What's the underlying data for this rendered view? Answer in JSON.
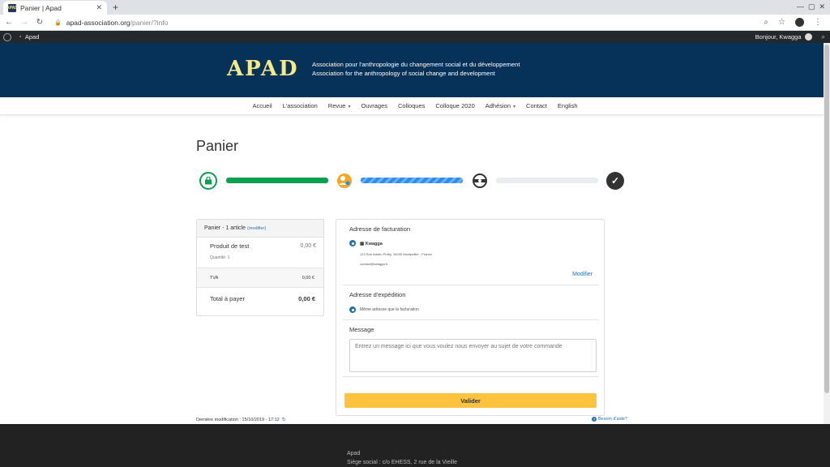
{
  "browser": {
    "tab_title": "Panier | Apad",
    "favicon_text": "APAD",
    "url_host": "apad-association.org",
    "url_path": "/panier/?info"
  },
  "wpbar": {
    "site_name": "Apad",
    "greeting": "Bonjour, Kwagga"
  },
  "header": {
    "logo": "APAD",
    "tagline_fr": "Association pour l'anthropologie du changement social et du développement",
    "tagline_en": "Association for the anthropology of social change and development"
  },
  "nav": {
    "items": [
      "Accueil",
      "L'association",
      "Revue",
      "Ouvrages",
      "Colloques",
      "Colloque 2020",
      "Adhésion",
      "Contact",
      "English"
    ]
  },
  "page": {
    "title": "Panier"
  },
  "steps": {
    "colors": {
      "done": "#0aa14e",
      "active": "#2d8cf0",
      "pending": "#e9ecef",
      "final": "#333333",
      "warn": "#f5a623"
    }
  },
  "cart": {
    "header_label": "Panier - 1 article",
    "modify_link": "(modifier)",
    "item_name": "Produit de test",
    "item_price": "0,00 €",
    "item_qty": "Quantité: 1",
    "tva_label": "TVA",
    "tva_value": "0,00 €",
    "total_label": "Total à payer",
    "total_value": "0,00 €"
  },
  "billing": {
    "title": "Adresse de facturation",
    "name": "Kwagga",
    "address": "123 Rue Adrien Proby, 34000 Montpellier - France",
    "email": "contact@kwagga.fr -",
    "modify": "Modifier"
  },
  "shipping": {
    "title": "Adresse d'expédition",
    "option": "Même adresse que la facturation"
  },
  "message": {
    "title": "Message",
    "placeholder": "Entrez un message ici que vous voulez nous envoyer au sujet de votre commande"
  },
  "actions": {
    "validate": "Valider"
  },
  "footer_info": {
    "last_mod": "Dernière modification : 15/10/2019 - 17:12",
    "help": "Besoin d'aide?",
    "footer_line1": "Apad",
    "footer_line2": "Siège social : c/o EHESS, 2 rue de la Vieille"
  }
}
